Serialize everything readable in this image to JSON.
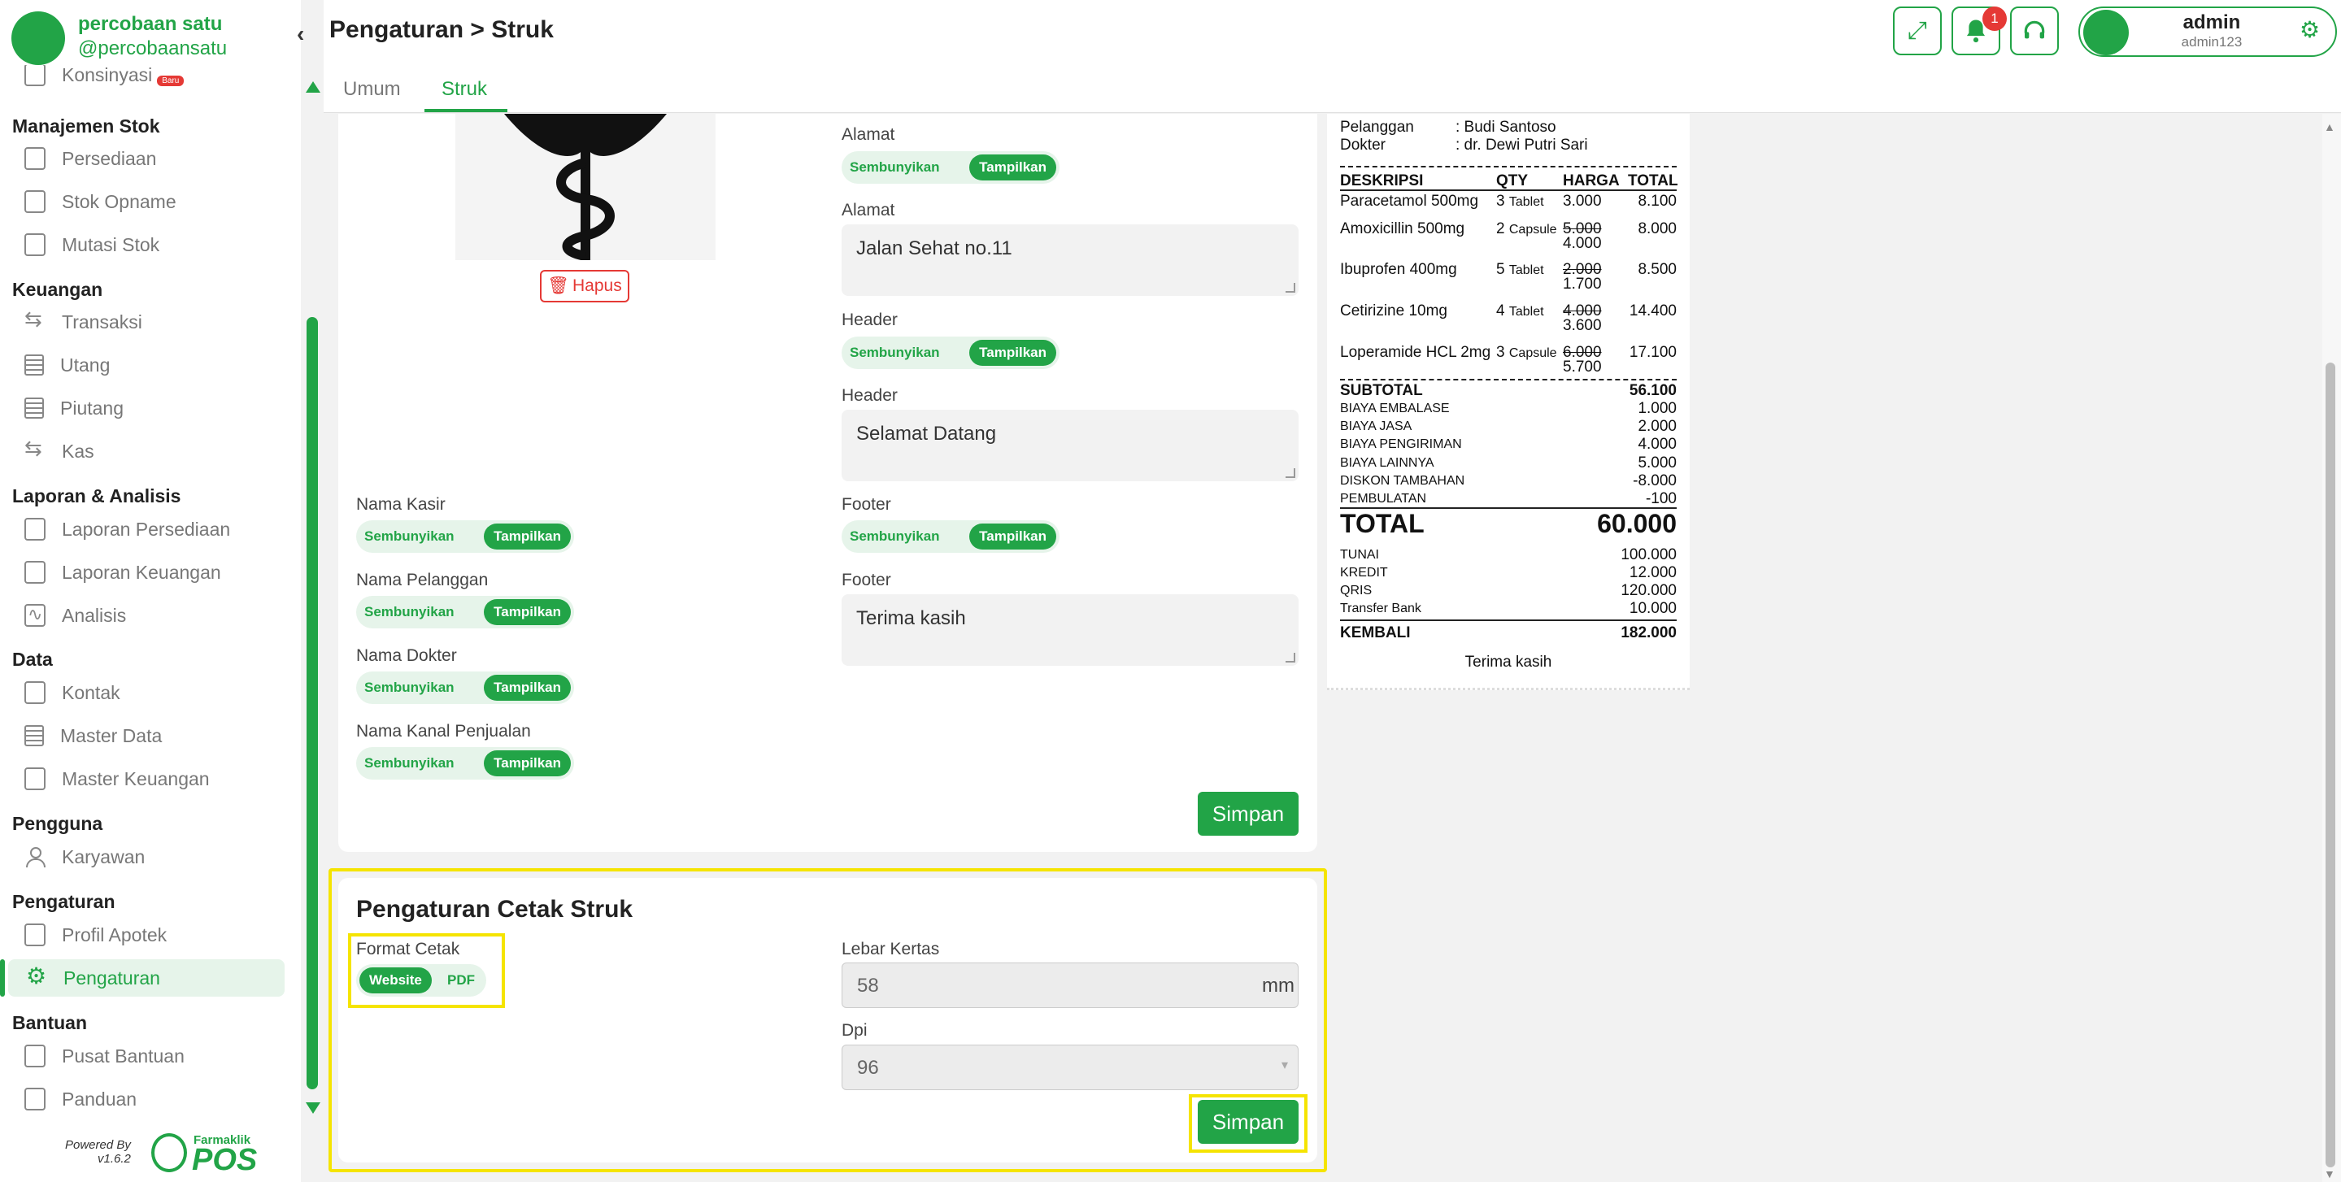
{
  "sidebar": {
    "app_name": "percobaan satu",
    "handle": "@percobaansatu",
    "partial_item": "Konsinyasi",
    "partial_badge": "Baru",
    "groups": [
      {
        "title": "Manajemen Stok",
        "items": [
          "Persediaan",
          "Stok Opname",
          "Mutasi Stok"
        ]
      },
      {
        "title": "Keuangan",
        "items": [
          "Transaksi",
          "Utang",
          "Piutang",
          "Kas"
        ]
      },
      {
        "title": "Laporan & Analisis",
        "items": [
          "Laporan Persediaan",
          "Laporan Keuangan",
          "Analisis"
        ]
      },
      {
        "title": "Data",
        "items": [
          "Kontak",
          "Master Data",
          "Master Keuangan"
        ]
      },
      {
        "title": "Pengguna",
        "items": [
          "Karyawan"
        ]
      },
      {
        "title": "Pengaturan",
        "items": [
          "Profil Apotek",
          "Pengaturan"
        ]
      },
      {
        "title": "Bantuan",
        "items": [
          "Pusat Bantuan",
          "Panduan"
        ]
      }
    ],
    "powered_by": "Powered By",
    "version": "v1.6.2",
    "brand_top": "Farmaklik",
    "brand_bottom": "POS"
  },
  "header": {
    "title": "Pengaturan > Struk",
    "notification_count": "1",
    "user_name": "admin",
    "user_login": "admin123",
    "colors": {
      "accent": "#22a447",
      "badge": "#e53935"
    }
  },
  "tabs": [
    {
      "label": "Umum"
    },
    {
      "label": "Struk"
    }
  ],
  "struk": {
    "hapus_label": "Hapus",
    "toggle_off": "Sembunyikan",
    "toggle_on": "Tampilkan",
    "alamat_label": "Alamat",
    "alamat_value": "Jalan Sehat no.11",
    "header_label": "Header",
    "header_value": "Selamat Datang",
    "footer_label": "Footer",
    "footer_value": "Terima kasih",
    "nama_kasir": "Nama Kasir",
    "nama_pelanggan": "Nama Pelanggan",
    "nama_dokter": "Nama Dokter",
    "nama_kanal": "Nama Kanal Penjualan",
    "save": "Simpan"
  },
  "cetak": {
    "title": "Pengaturan Cetak Struk",
    "format_label": "Format Cetak",
    "format_options": [
      "Website",
      "PDF"
    ],
    "lebar_label": "Lebar Kertas",
    "lebar_value": "58",
    "lebar_unit": "mm",
    "dpi_label": "Dpi",
    "dpi_value": "96",
    "save": "Simpan"
  },
  "receipt": {
    "pelanggan_label": "Pelanggan",
    "pelanggan_value": ": Budi Santoso",
    "dokter_label": "Dokter",
    "dokter_value": ": dr. Dewi Putri Sari",
    "col_desc": "DESKRIPSI",
    "col_qty": "QTY",
    "col_harga": "HARGA",
    "col_total": "TOTAL",
    "items": [
      {
        "name": "Paracetamol 500mg",
        "qty": "3",
        "unit": "Tablet",
        "old": "",
        "price": "3.000",
        "total": "8.100"
      },
      {
        "name": "Amoxicillin 500mg",
        "qty": "2",
        "unit": "Capsule",
        "old": "5.000",
        "price": "4.000",
        "total": "8.000"
      },
      {
        "name": "Ibuprofen 400mg",
        "qty": "5",
        "unit": "Tablet",
        "old": "2.000",
        "price": "1.700",
        "total": "8.500"
      },
      {
        "name": "Cetirizine 10mg",
        "qty": "4",
        "unit": "Tablet",
        "old": "4.000",
        "price": "3.600",
        "total": "14.400"
      },
      {
        "name": "Loperamide HCL 2mg",
        "qty": "3",
        "unit": "Capsule",
        "old": "6.000",
        "price": "5.700",
        "total": "17.100"
      }
    ],
    "subtotal_label": "SUBTOTAL",
    "subtotal_value": "56.100",
    "fees": [
      {
        "label": "BIAYA EMBALASE",
        "value": "1.000"
      },
      {
        "label": "BIAYA JASA",
        "value": "2.000"
      },
      {
        "label": "BIAYA PENGIRIMAN",
        "value": "4.000"
      },
      {
        "label": "BIAYA LAINNYA",
        "value": "5.000"
      },
      {
        "label": "DISKON TAMBAHAN",
        "value": "-8.000"
      },
      {
        "label": "PEMBULATAN",
        "value": "-100"
      }
    ],
    "total_label": "TOTAL",
    "total_value": "60.000",
    "payments": [
      {
        "label": "TUNAI",
        "value": "100.000"
      },
      {
        "label": "KREDIT",
        "value": "12.000"
      },
      {
        "label": "QRIS",
        "value": "120.000"
      },
      {
        "label": "Transfer Bank",
        "value": "10.000"
      }
    ],
    "kembali_label": "KEMBALI",
    "kembali_value": "182.000",
    "footer": "Terima kasih"
  }
}
